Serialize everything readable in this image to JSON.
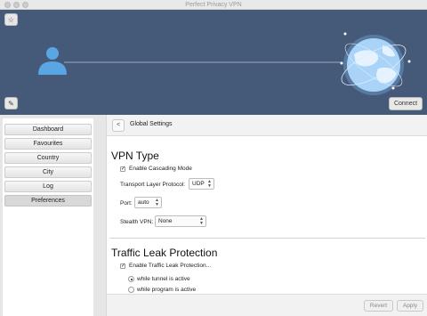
{
  "window": {
    "title": "Perfect Privacy VPN"
  },
  "hero": {
    "star_button_icon": "star-icon",
    "tools_button_icon": "tools-icon",
    "connect_label": "Connect"
  },
  "nav": {
    "items": [
      {
        "label": "Dashboard"
      },
      {
        "label": "Favourites"
      },
      {
        "label": "Country"
      },
      {
        "label": "City"
      },
      {
        "label": "Log"
      },
      {
        "label": "Preferences"
      }
    ],
    "selected": "Preferences"
  },
  "main": {
    "back_label": "<",
    "title": "Global Settings",
    "vpn_type": {
      "heading": "VPN Type",
      "cascading_label": "Enable Cascading Mode",
      "cascading_checked": true,
      "transport_label": "Transport Layer Protocol:",
      "transport_value": "UDP",
      "port_label": "Port:",
      "port_value": "auto",
      "stealth_label": "Stealth VPN:",
      "stealth_value": "None"
    },
    "traffic_leak": {
      "heading": "Traffic Leak Protection",
      "enable_label": "Enable Traffic Leak Protection...",
      "enable_checked": true,
      "option_tunnel": "while tunnel is active",
      "option_program": "while program is active",
      "selected_option": "while tunnel is active"
    },
    "footer": {
      "revert_label": "Revert",
      "apply_label": "Apply"
    }
  },
  "colors": {
    "hero_bg": "#455a79",
    "user_icon": "#5aa6e3",
    "globe": "#bfe0ff"
  }
}
